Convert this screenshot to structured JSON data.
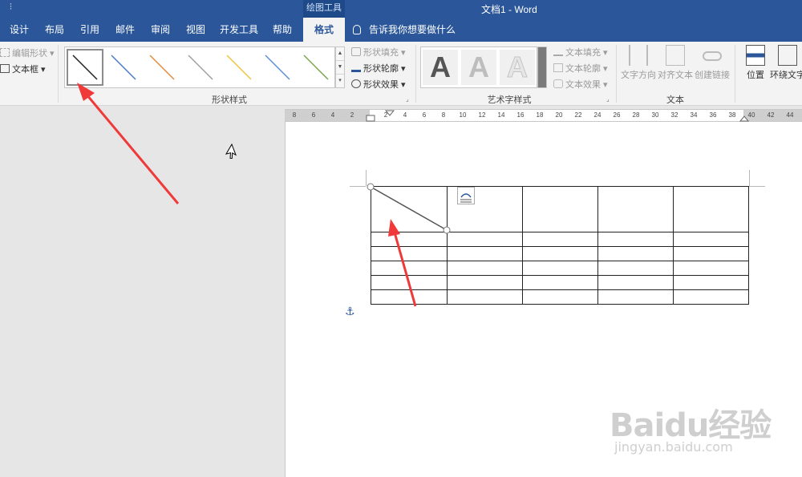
{
  "title_bar": {
    "qat_label": "⫶",
    "context_group": "绘图工具",
    "document_title": "文档1  -  Word"
  },
  "tabs": [
    "设计",
    "布局",
    "引用",
    "邮件",
    "审阅",
    "视图",
    "开发工具",
    "帮助",
    "格式"
  ],
  "active_tab": "格式",
  "tell_me": "告诉我你想要做什么",
  "ribbon": {
    "insert_shapes": {
      "edit_shape": "编辑形状",
      "text_box": "文本框"
    },
    "shape_styles": {
      "label": "形状样式",
      "fill": "形状填充",
      "outline": "形状轮廓",
      "effects": "形状效果",
      "swatch_colors": [
        "#222222",
        "#4a7bc8",
        "#e08a3c",
        "#9e9e9e",
        "#f2c53d",
        "#5b8fd6",
        "#7aa34a"
      ]
    },
    "wordart_styles": {
      "label": "艺术字样式",
      "glyph": "A",
      "text_fill": "文本填充",
      "text_outline": "文本轮廓",
      "text_effects": "文本效果"
    },
    "text_group": {
      "label": "文本",
      "direction": "文字方向",
      "align": "对齐文本",
      "link": "创建链接"
    },
    "arrange": {
      "position": "位置",
      "wrap": "环绕文字"
    }
  },
  "ruler": {
    "left_numbers": [
      "8",
      "6",
      "4",
      "2"
    ],
    "right_numbers": [
      "2",
      "4",
      "6",
      "8",
      "10",
      "12",
      "14",
      "16",
      "18",
      "20",
      "22",
      "24",
      "26",
      "28",
      "30",
      "32",
      "34",
      "36",
      "38",
      "40",
      "42",
      "44"
    ]
  },
  "watermark": {
    "brand": "Baidu经验",
    "url": "jingyan.baidu.com"
  },
  "colors": {
    "word_blue": "#2b579a",
    "arrow_red": "#f03a3a"
  }
}
